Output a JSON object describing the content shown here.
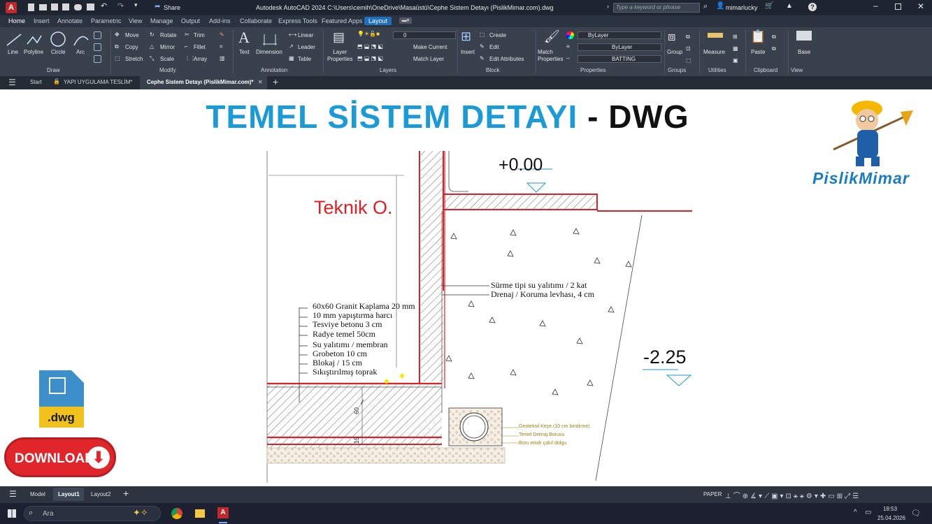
{
  "titlebar": {
    "app_letter": "A",
    "share": "Share",
    "title": "Autodesk AutoCAD 2024   C:\\Users\\cemih\\OneDrive\\Masaüstü\\Cephe Sistem Detayı (PislikMimar.com).dwg",
    "search_placeholder": "Type a keyword or phrase",
    "user": "mimarlucky"
  },
  "ribbon_tabs": [
    "Home",
    "Insert",
    "Annotate",
    "Parametric",
    "View",
    "Manage",
    "Output",
    "Add-ins",
    "Collaborate",
    "Express Tools",
    "Featured Apps",
    "Layout"
  ],
  "ribbon": {
    "draw": {
      "label": "Draw",
      "tools": [
        "Line",
        "Polyline",
        "Circle",
        "Arc"
      ]
    },
    "modify": {
      "label": "Modify",
      "tools": [
        "Move",
        "Rotate",
        "Trim",
        "Copy",
        "Mirror",
        "Fillet",
        "Stretch",
        "Scale",
        "Array"
      ]
    },
    "annotation": {
      "label": "Annotation",
      "tools": [
        "Text",
        "Dimension",
        "Linear",
        "Leader",
        "Table"
      ]
    },
    "layers": {
      "label": "Layers",
      "layer_props": "Layer\nProperties",
      "current_layer": "0",
      "tools": [
        "Make Current",
        "Match Layer"
      ]
    },
    "block": {
      "label": "Block",
      "tools": [
        "Insert",
        "Create",
        "Edit",
        "Edit Attributes"
      ]
    },
    "properties": {
      "label": "Properties",
      "match": "Match\nProperties",
      "color": "ByLayer",
      "lineweight": "ByLayer",
      "linetype": "BATTING"
    },
    "groups": {
      "label": "Groups",
      "tool": "Group"
    },
    "utilities": {
      "label": "Utilities",
      "tool": "Measure"
    },
    "clipboard": {
      "label": "Clipboard",
      "tool": "Paste"
    },
    "view": {
      "label": "View",
      "tool": "Base"
    }
  },
  "file_tabs": [
    "Start",
    "YAPI UYGULAMA TESLİM*",
    "Cephe Sistem Detayı (PislikMimar.com)*"
  ],
  "drawing": {
    "heading_blue": "TEMEL SİSTEM DETAYI",
    "heading_dash": " - ",
    "heading_black": "DWG",
    "room_label": "Teknik O.",
    "level_top": "+0.00",
    "level_bottom": "-2.25",
    "layers_list": [
      "60x60 Granit Kaplama 20 mm",
      "10 mm yapıştırma harcı",
      "Tesviye betonu 3 cm",
      "Radye temel 50cm",
      "Su yalıtımı / membran",
      "Grobeton 10 cm",
      "Blokaj / 15 cm",
      "Sıkıştırılmış toprak"
    ],
    "wall_notes": [
      "Sürme tipi su yalıtımı / 2 kat",
      "Drenaj / Koruma levhası, 4 cm"
    ],
    "drain_notes": [
      "Geoteksil Keçe (10 cm bindirme)",
      "Temel Drenaj Borusu",
      "Boru etrafı çakıl dolgu"
    ],
    "dim_vertical": "60",
    "dim_small": "15"
  },
  "brand": {
    "name": "PislikMimar",
    "file_badge": ".dwg",
    "download": "DOWNLOAD"
  },
  "statusbar": {
    "tabs": [
      "Model",
      "Layout1",
      "Layout2"
    ],
    "paper": "PAPER"
  },
  "taskbar": {
    "search_placeholder": "Ara",
    "time": "18:53",
    "date": "25.04.2026"
  },
  "colors": {
    "accent": "#1a9ad6",
    "red": "#e31e24",
    "ribbon": "#39414d"
  }
}
